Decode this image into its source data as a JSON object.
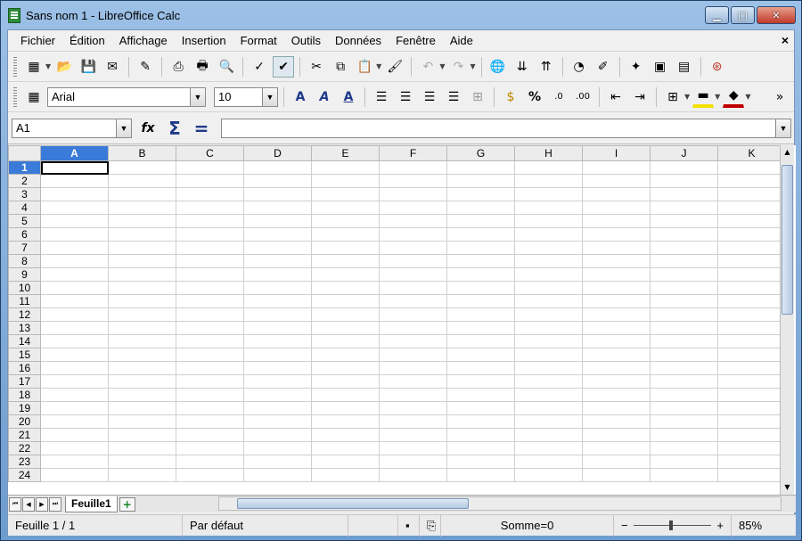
{
  "window": {
    "title": "Sans nom 1 - LibreOffice Calc"
  },
  "menu": [
    "Fichier",
    "Édition",
    "Affichage",
    "Insertion",
    "Format",
    "Outils",
    "Données",
    "Fenêtre",
    "Aide"
  ],
  "font": {
    "name": "Arial",
    "size": "10"
  },
  "namebox": {
    "value": "A1"
  },
  "formula": {
    "sum": "Σ",
    "equals": "="
  },
  "columns": [
    "A",
    "B",
    "C",
    "D",
    "E",
    "F",
    "G",
    "H",
    "I",
    "J",
    "K"
  ],
  "rows": [
    "1",
    "2",
    "3",
    "4",
    "5",
    "6",
    "7",
    "8",
    "9",
    "10",
    "11",
    "12",
    "13",
    "14",
    "15",
    "16",
    "17",
    "18",
    "19",
    "20",
    "21",
    "22",
    "23",
    "24"
  ],
  "sheet_tab": "Feuille1",
  "status": {
    "sheet": "Feuille 1 / 1",
    "style": "Par défaut",
    "sum": "Somme=0",
    "zoom": "85%"
  }
}
